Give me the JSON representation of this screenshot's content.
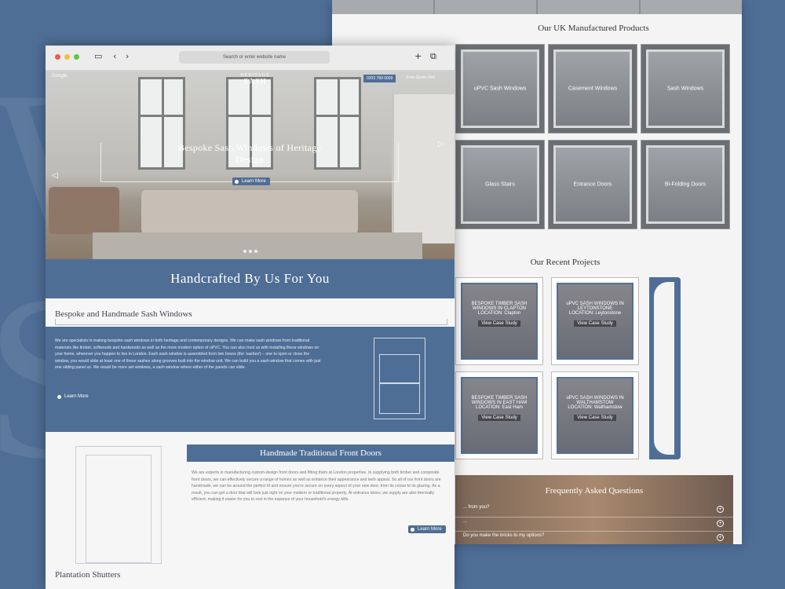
{
  "colors": {
    "brand": "#4f6e96",
    "background": "#4f6e96",
    "page": "#f4f4f4"
  },
  "browser": {
    "address_placeholder": "Search or enter website name"
  },
  "header": {
    "google": "Google",
    "logo": "SASH",
    "logo_pre": "HERITAGE",
    "phone": "0203 789 0000",
    "quote": "Free Quote Visit"
  },
  "hero": {
    "title": "Bespoke Sash Windows of Heritage Design",
    "cta": "Learn More"
  },
  "band": {
    "title": "Handcrafted By Us For You"
  },
  "bespoke": {
    "title": "Bespoke and Handmade Sash Windows",
    "text": "We are specialists in making bespoke sash windows in both heritage and contemporary designs. We can make sash windows from traditional materials like timber, softwoods and hardwoods as well as the more modern option of uPVC. You can also trust us with installing these windows on your home, wherever you happen to live in London. Each sash window is assembled from two boxes (the 'sashes') – one to open or close the window, you would slide at least one of these sashes along grooves built into the window unit. We can build you a sash window that comes with just one sliding panel so. We would be more set windows, a sash window where either of the panels can slide.",
    "cta": "Learn More"
  },
  "doors": {
    "title": "Handmade Traditional Front Doors",
    "text": "We are experts in manufacturing custom-design front doors and fitting them at London properties. In supplying both timber and composite front doors, we can effectively secure a range of homes as well as enhance their appearance and kerb appeal. So all of our front doors are handmade, we can be around the perfect fit and ensure you're secure on every aspect of your new door, from its colour to its glazing. As a result, you can get a door that will look just right on your modern or traditional property. At entrance doors, we supply are also thermally efficient, making it easier for you to rest in the expense of your household's energy bills.",
    "cta": "Learn More"
  },
  "shutters": {
    "title": "Plantation Shutters"
  },
  "products": {
    "title": "Our UK Manufactured Products",
    "items": [
      {
        "label": "uPVC Sash Windows"
      },
      {
        "label": "Casement Windows"
      },
      {
        "label": "Sash Windows"
      },
      {
        "label": "Glass Stairs"
      },
      {
        "label": "Entrance Doors"
      },
      {
        "label": "Bi-Folding Doors"
      }
    ]
  },
  "projects": {
    "title": "Our Recent Projects",
    "items": [
      {
        "title": "BESPOKE TIMBER SASH WINDOWS IN CLAPTON",
        "location": "LOCATION: Clapton",
        "cta": "View Case Study"
      },
      {
        "title": "uPVC SASH WINDOWS IN LEYTONSTONE",
        "location": "LOCATION: Leytonstone",
        "cta": "View Case Study"
      },
      {
        "title": "BESPOKE TIMBER SASH WINDOWS IN EAST HAM",
        "location": "LOCATION: East Ham",
        "cta": "View Case Study"
      },
      {
        "title": "uPVC SASH WINDOWS IN WALTHAMSTOW",
        "location": "LOCATION: Walthamstow",
        "cta": "View Case Study"
      }
    ]
  },
  "faq": {
    "title": "Frequently Asked Questions",
    "rows": [
      {
        "q": "... from you?"
      },
      {
        "q": "..."
      },
      {
        "q": "Do you make the bricks to my options?"
      }
    ]
  }
}
